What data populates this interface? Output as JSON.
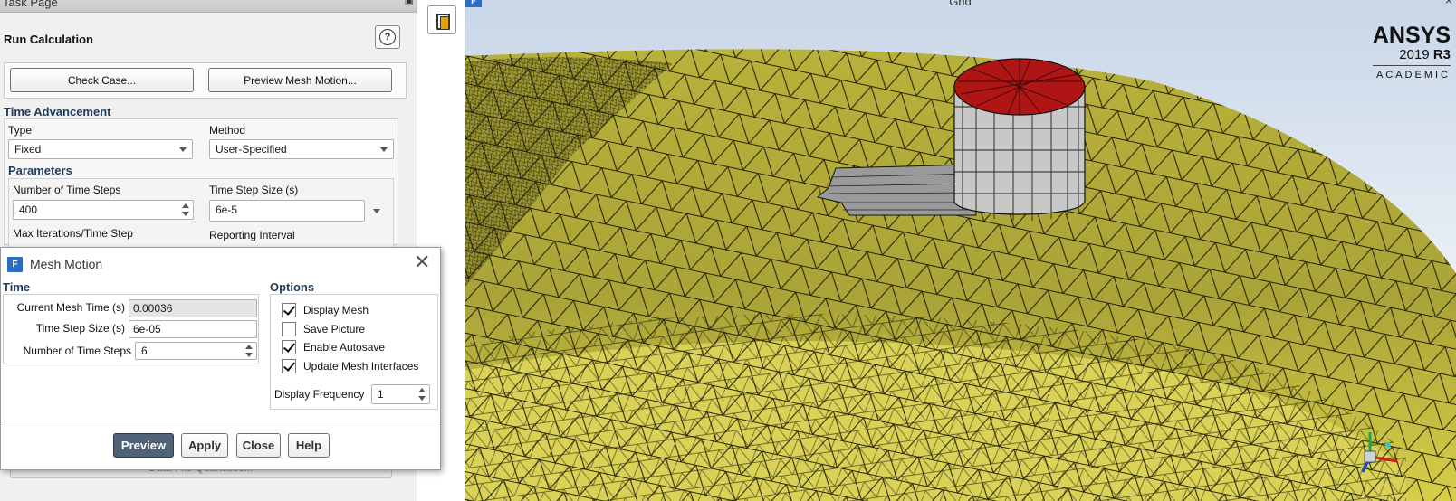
{
  "task_page": {
    "title": "Task Page",
    "heading": "Run Calculation",
    "help_glyph": "?",
    "check_case_label": "Check Case...",
    "preview_mesh_motion_label": "Preview Mesh Motion...",
    "time_advancement": {
      "heading": "Time Advancement",
      "type_label": "Type",
      "type_value": "Fixed",
      "method_label": "Method",
      "method_value": "User-Specified"
    },
    "parameters": {
      "heading": "Parameters",
      "num_steps_label": "Number of Time Steps",
      "num_steps_value": "400",
      "step_size_label": "Time Step Size (s)",
      "step_size_value": "6e-5",
      "max_iter_label": "Max Iterations/Time Step",
      "reporting_interval_label": "Reporting Interval"
    },
    "data_file_quantities_label": "Data File Quantities..."
  },
  "viewport": {
    "title": "Grid",
    "icon_letter": "F",
    "close_glyph": "×",
    "logo": {
      "line1": "ANSYS",
      "version": "2019",
      "release": "R3",
      "line3": "ACADEMIC"
    },
    "colors": {
      "mesh_surface": "#c9c23a",
      "cylinder_top": "#b01515",
      "cylinder_side": "#c8c8c8"
    }
  },
  "mesh_motion": {
    "title": "Mesh Motion",
    "icon_letter": "F",
    "close_glyph": "✕",
    "time_heading": "Time",
    "current_time_label": "Current Mesh Time (s)",
    "current_time_value": "0.00036",
    "step_size_label": "Time Step Size (s)",
    "step_size_value": "6e-05",
    "num_steps_label": "Number of Time Steps",
    "num_steps_value": "6",
    "options_heading": "Options",
    "options": [
      {
        "label": "Display Mesh",
        "checked": true
      },
      {
        "label": "Save Picture",
        "checked": false
      },
      {
        "label": "Enable Autosave",
        "checked": true
      },
      {
        "label": "Update Mesh Interfaces",
        "checked": true
      }
    ],
    "display_frequency_label": "Display Frequency",
    "display_frequency_value": "1",
    "buttons": {
      "preview": "Preview",
      "apply": "Apply",
      "close": "Close",
      "help": "Help"
    }
  }
}
